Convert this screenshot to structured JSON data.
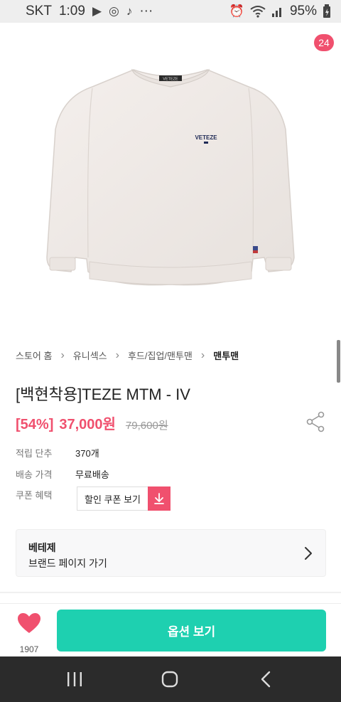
{
  "status_bar": {
    "carrier": "SKT",
    "time": "1:09",
    "more": "···",
    "battery": "95%"
  },
  "header": {
    "cart_count": "24"
  },
  "breadcrumb": {
    "items": [
      "스토어 홈",
      "유니섹스",
      "후드/집업/맨투맨",
      "맨투맨"
    ]
  },
  "product": {
    "title": "[백현착용]TEZE MTM - IV",
    "discount": "[54%]",
    "price": "37,000원",
    "original_price": "79,600원",
    "shirt_logo": "VETEZE",
    "shirt_tag": "VETEZE"
  },
  "info": {
    "points_label": "적립 단추",
    "points_value": "370개",
    "shipping_label": "배송 가격",
    "shipping_value": "무료배송",
    "coupon_label": "쿠폰 혜택",
    "coupon_button": "할인 쿠폰 보기"
  },
  "brand": {
    "name": "베테제",
    "link": "브랜드 페이지 가기"
  },
  "bottom_bar": {
    "like_count": "1907",
    "option_button": "옵션 보기"
  },
  "colors": {
    "accent_pink": "#f0506e",
    "accent_teal": "#1ed0b0"
  }
}
